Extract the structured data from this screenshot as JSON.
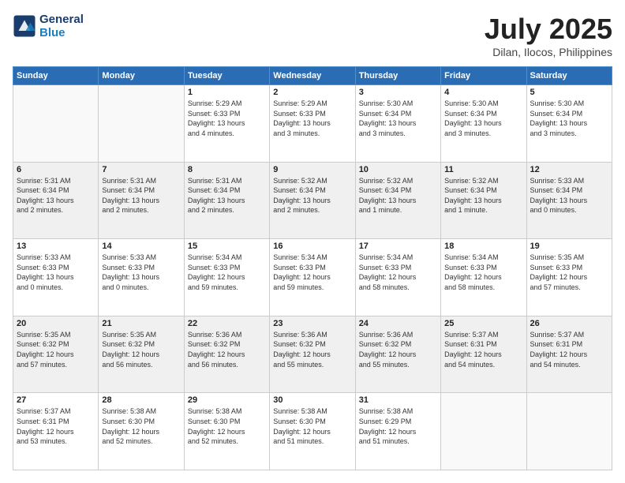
{
  "header": {
    "logo_line1": "General",
    "logo_line2": "Blue",
    "month": "July 2025",
    "location": "Dilan, Ilocos, Philippines"
  },
  "weekdays": [
    "Sunday",
    "Monday",
    "Tuesday",
    "Wednesday",
    "Thursday",
    "Friday",
    "Saturday"
  ],
  "weeks": [
    [
      {
        "day": "",
        "info": ""
      },
      {
        "day": "",
        "info": ""
      },
      {
        "day": "1",
        "info": "Sunrise: 5:29 AM\nSunset: 6:33 PM\nDaylight: 13 hours\nand 4 minutes."
      },
      {
        "day": "2",
        "info": "Sunrise: 5:29 AM\nSunset: 6:33 PM\nDaylight: 13 hours\nand 3 minutes."
      },
      {
        "day": "3",
        "info": "Sunrise: 5:30 AM\nSunset: 6:34 PM\nDaylight: 13 hours\nand 3 minutes."
      },
      {
        "day": "4",
        "info": "Sunrise: 5:30 AM\nSunset: 6:34 PM\nDaylight: 13 hours\nand 3 minutes."
      },
      {
        "day": "5",
        "info": "Sunrise: 5:30 AM\nSunset: 6:34 PM\nDaylight: 13 hours\nand 3 minutes."
      }
    ],
    [
      {
        "day": "6",
        "info": "Sunrise: 5:31 AM\nSunset: 6:34 PM\nDaylight: 13 hours\nand 2 minutes."
      },
      {
        "day": "7",
        "info": "Sunrise: 5:31 AM\nSunset: 6:34 PM\nDaylight: 13 hours\nand 2 minutes."
      },
      {
        "day": "8",
        "info": "Sunrise: 5:31 AM\nSunset: 6:34 PM\nDaylight: 13 hours\nand 2 minutes."
      },
      {
        "day": "9",
        "info": "Sunrise: 5:32 AM\nSunset: 6:34 PM\nDaylight: 13 hours\nand 2 minutes."
      },
      {
        "day": "10",
        "info": "Sunrise: 5:32 AM\nSunset: 6:34 PM\nDaylight: 13 hours\nand 1 minute."
      },
      {
        "day": "11",
        "info": "Sunrise: 5:32 AM\nSunset: 6:34 PM\nDaylight: 13 hours\nand 1 minute."
      },
      {
        "day": "12",
        "info": "Sunrise: 5:33 AM\nSunset: 6:34 PM\nDaylight: 13 hours\nand 0 minutes."
      }
    ],
    [
      {
        "day": "13",
        "info": "Sunrise: 5:33 AM\nSunset: 6:33 PM\nDaylight: 13 hours\nand 0 minutes."
      },
      {
        "day": "14",
        "info": "Sunrise: 5:33 AM\nSunset: 6:33 PM\nDaylight: 13 hours\nand 0 minutes."
      },
      {
        "day": "15",
        "info": "Sunrise: 5:34 AM\nSunset: 6:33 PM\nDaylight: 12 hours\nand 59 minutes."
      },
      {
        "day": "16",
        "info": "Sunrise: 5:34 AM\nSunset: 6:33 PM\nDaylight: 12 hours\nand 59 minutes."
      },
      {
        "day": "17",
        "info": "Sunrise: 5:34 AM\nSunset: 6:33 PM\nDaylight: 12 hours\nand 58 minutes."
      },
      {
        "day": "18",
        "info": "Sunrise: 5:34 AM\nSunset: 6:33 PM\nDaylight: 12 hours\nand 58 minutes."
      },
      {
        "day": "19",
        "info": "Sunrise: 5:35 AM\nSunset: 6:33 PM\nDaylight: 12 hours\nand 57 minutes."
      }
    ],
    [
      {
        "day": "20",
        "info": "Sunrise: 5:35 AM\nSunset: 6:32 PM\nDaylight: 12 hours\nand 57 minutes."
      },
      {
        "day": "21",
        "info": "Sunrise: 5:35 AM\nSunset: 6:32 PM\nDaylight: 12 hours\nand 56 minutes."
      },
      {
        "day": "22",
        "info": "Sunrise: 5:36 AM\nSunset: 6:32 PM\nDaylight: 12 hours\nand 56 minutes."
      },
      {
        "day": "23",
        "info": "Sunrise: 5:36 AM\nSunset: 6:32 PM\nDaylight: 12 hours\nand 55 minutes."
      },
      {
        "day": "24",
        "info": "Sunrise: 5:36 AM\nSunset: 6:32 PM\nDaylight: 12 hours\nand 55 minutes."
      },
      {
        "day": "25",
        "info": "Sunrise: 5:37 AM\nSunset: 6:31 PM\nDaylight: 12 hours\nand 54 minutes."
      },
      {
        "day": "26",
        "info": "Sunrise: 5:37 AM\nSunset: 6:31 PM\nDaylight: 12 hours\nand 54 minutes."
      }
    ],
    [
      {
        "day": "27",
        "info": "Sunrise: 5:37 AM\nSunset: 6:31 PM\nDaylight: 12 hours\nand 53 minutes."
      },
      {
        "day": "28",
        "info": "Sunrise: 5:38 AM\nSunset: 6:30 PM\nDaylight: 12 hours\nand 52 minutes."
      },
      {
        "day": "29",
        "info": "Sunrise: 5:38 AM\nSunset: 6:30 PM\nDaylight: 12 hours\nand 52 minutes."
      },
      {
        "day": "30",
        "info": "Sunrise: 5:38 AM\nSunset: 6:30 PM\nDaylight: 12 hours\nand 51 minutes."
      },
      {
        "day": "31",
        "info": "Sunrise: 5:38 AM\nSunset: 6:29 PM\nDaylight: 12 hours\nand 51 minutes."
      },
      {
        "day": "",
        "info": ""
      },
      {
        "day": "",
        "info": ""
      }
    ]
  ]
}
